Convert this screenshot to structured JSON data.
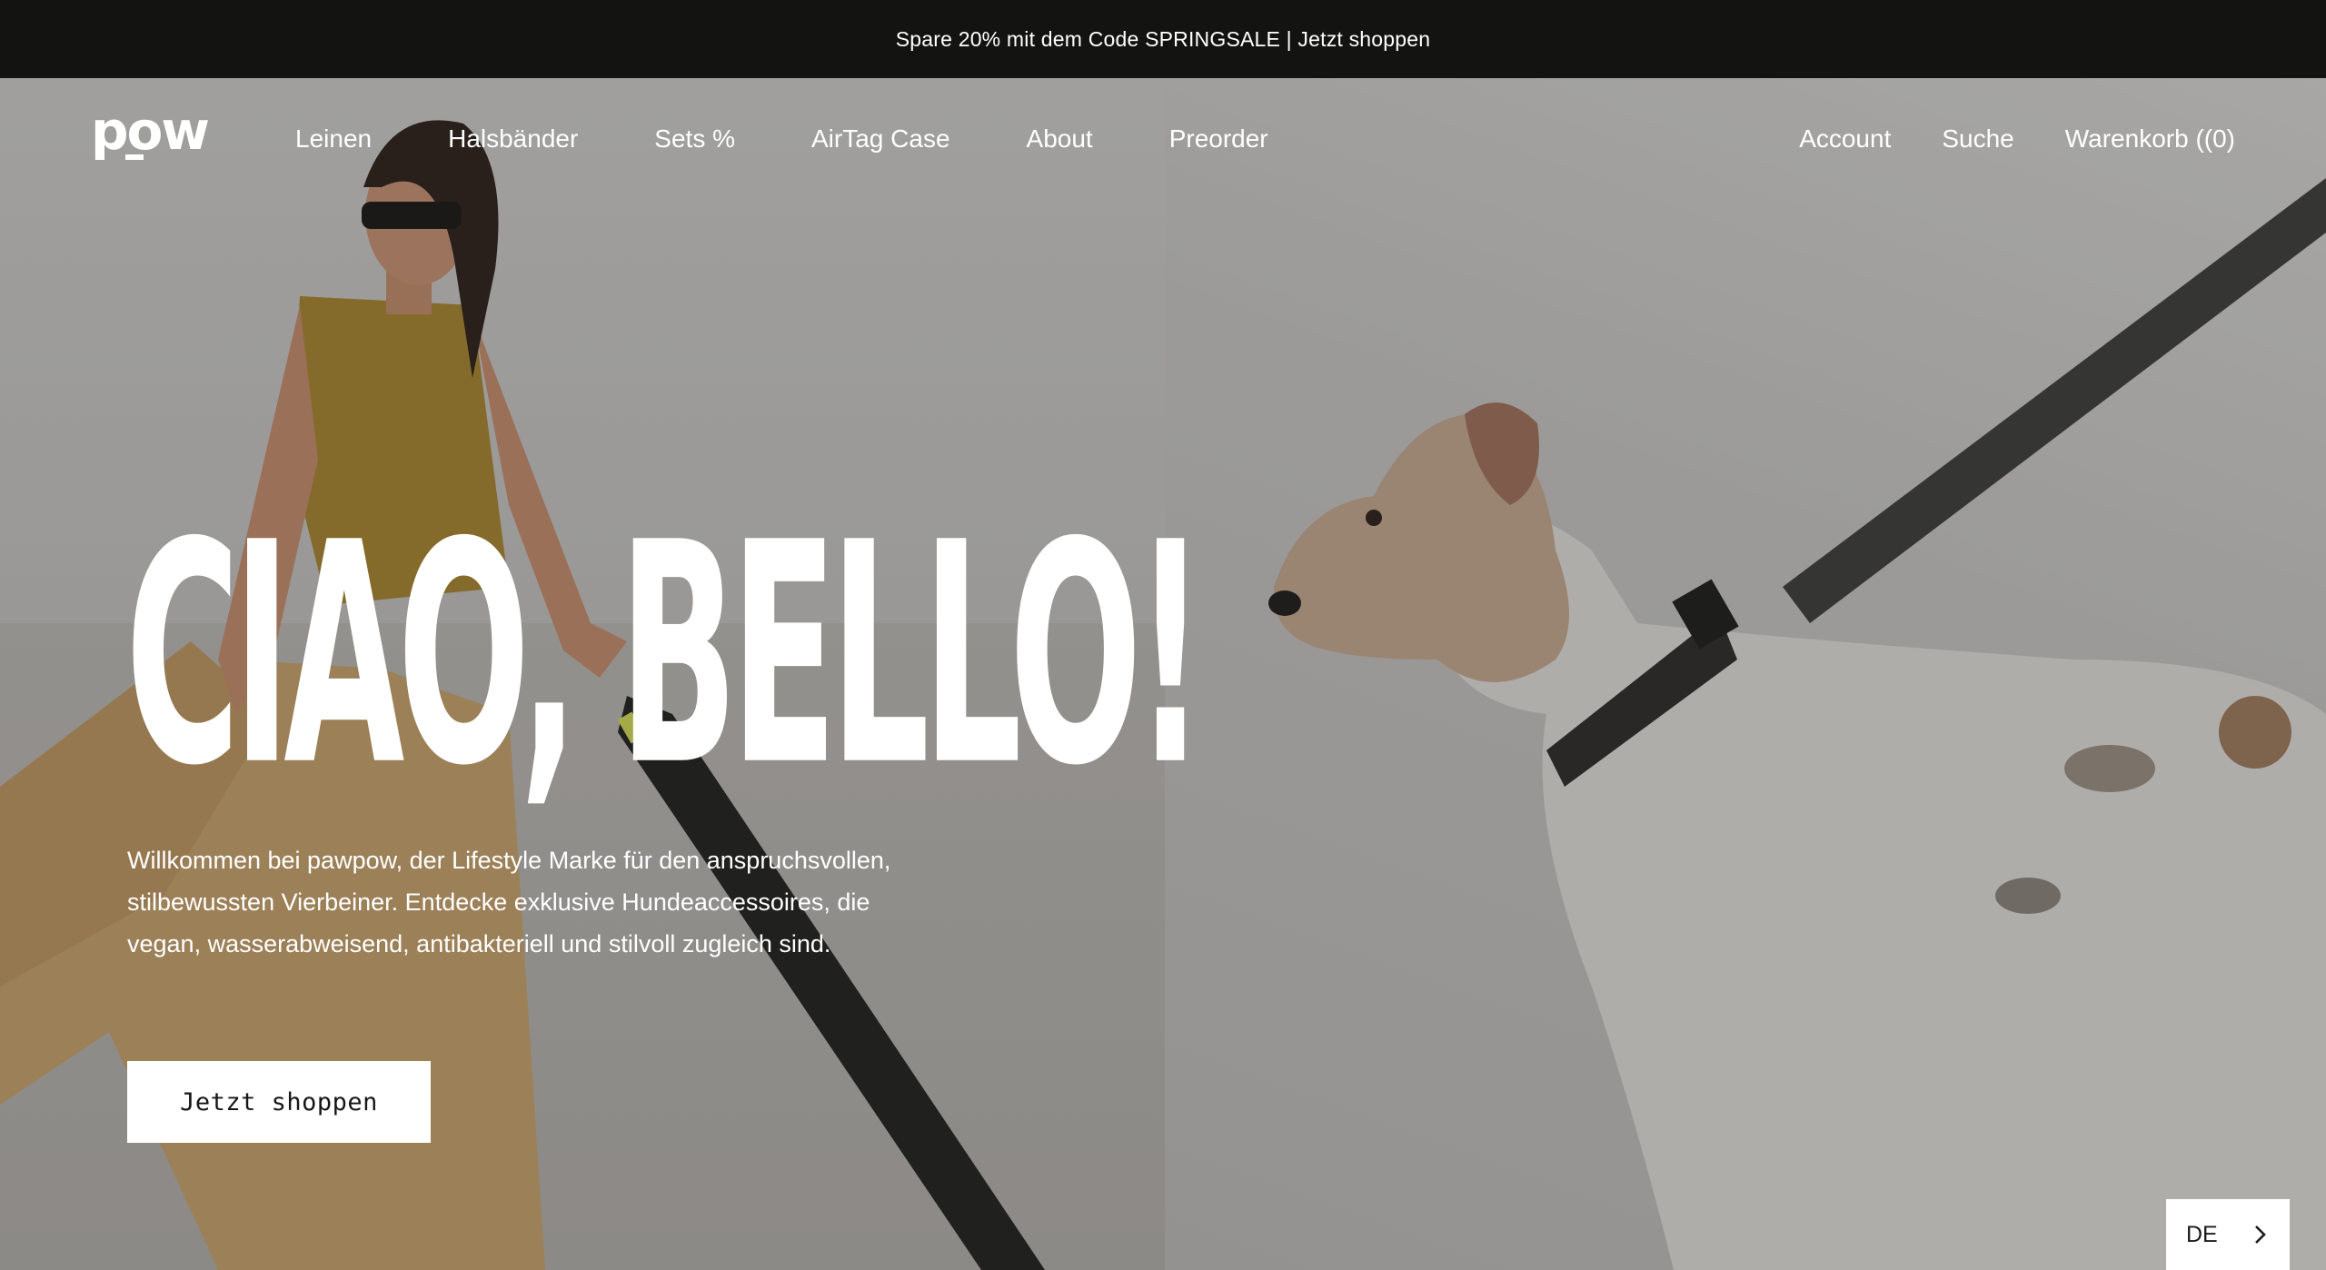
{
  "announcement": {
    "text": "Spare 20% mit dem Code SPRINGSALE | Jetzt shoppen"
  },
  "header": {
    "logo_text": "pow",
    "nav_left": [
      {
        "label": "Leinen"
      },
      {
        "label": "Halsbänder"
      },
      {
        "label": "Sets %"
      },
      {
        "label": "AirTag Case"
      },
      {
        "label": "About"
      },
      {
        "label": "Preorder"
      }
    ],
    "nav_right": [
      {
        "label": "Account"
      },
      {
        "label": "Suche"
      },
      {
        "label": "Warenkorb ((0)"
      }
    ]
  },
  "hero": {
    "headline": "CIAO, BELLO!",
    "intro": "Willkommen bei pawpow, der Lifestyle Marke für den anspruchsvollen, stilbewussten Vierbeiner. Entdecke exklusive Hundeaccessoires, die vegan, wasserabweisend, antibakteriell und stilvoll zugleich sind.",
    "cta_label": "Jetzt shoppen"
  },
  "language_selector": {
    "value": "DE",
    "icon": "chevron-right-icon"
  },
  "colors": {
    "announcement_bg": "#131312",
    "text_light": "#ffffff",
    "cta_bg": "#ffffff"
  }
}
